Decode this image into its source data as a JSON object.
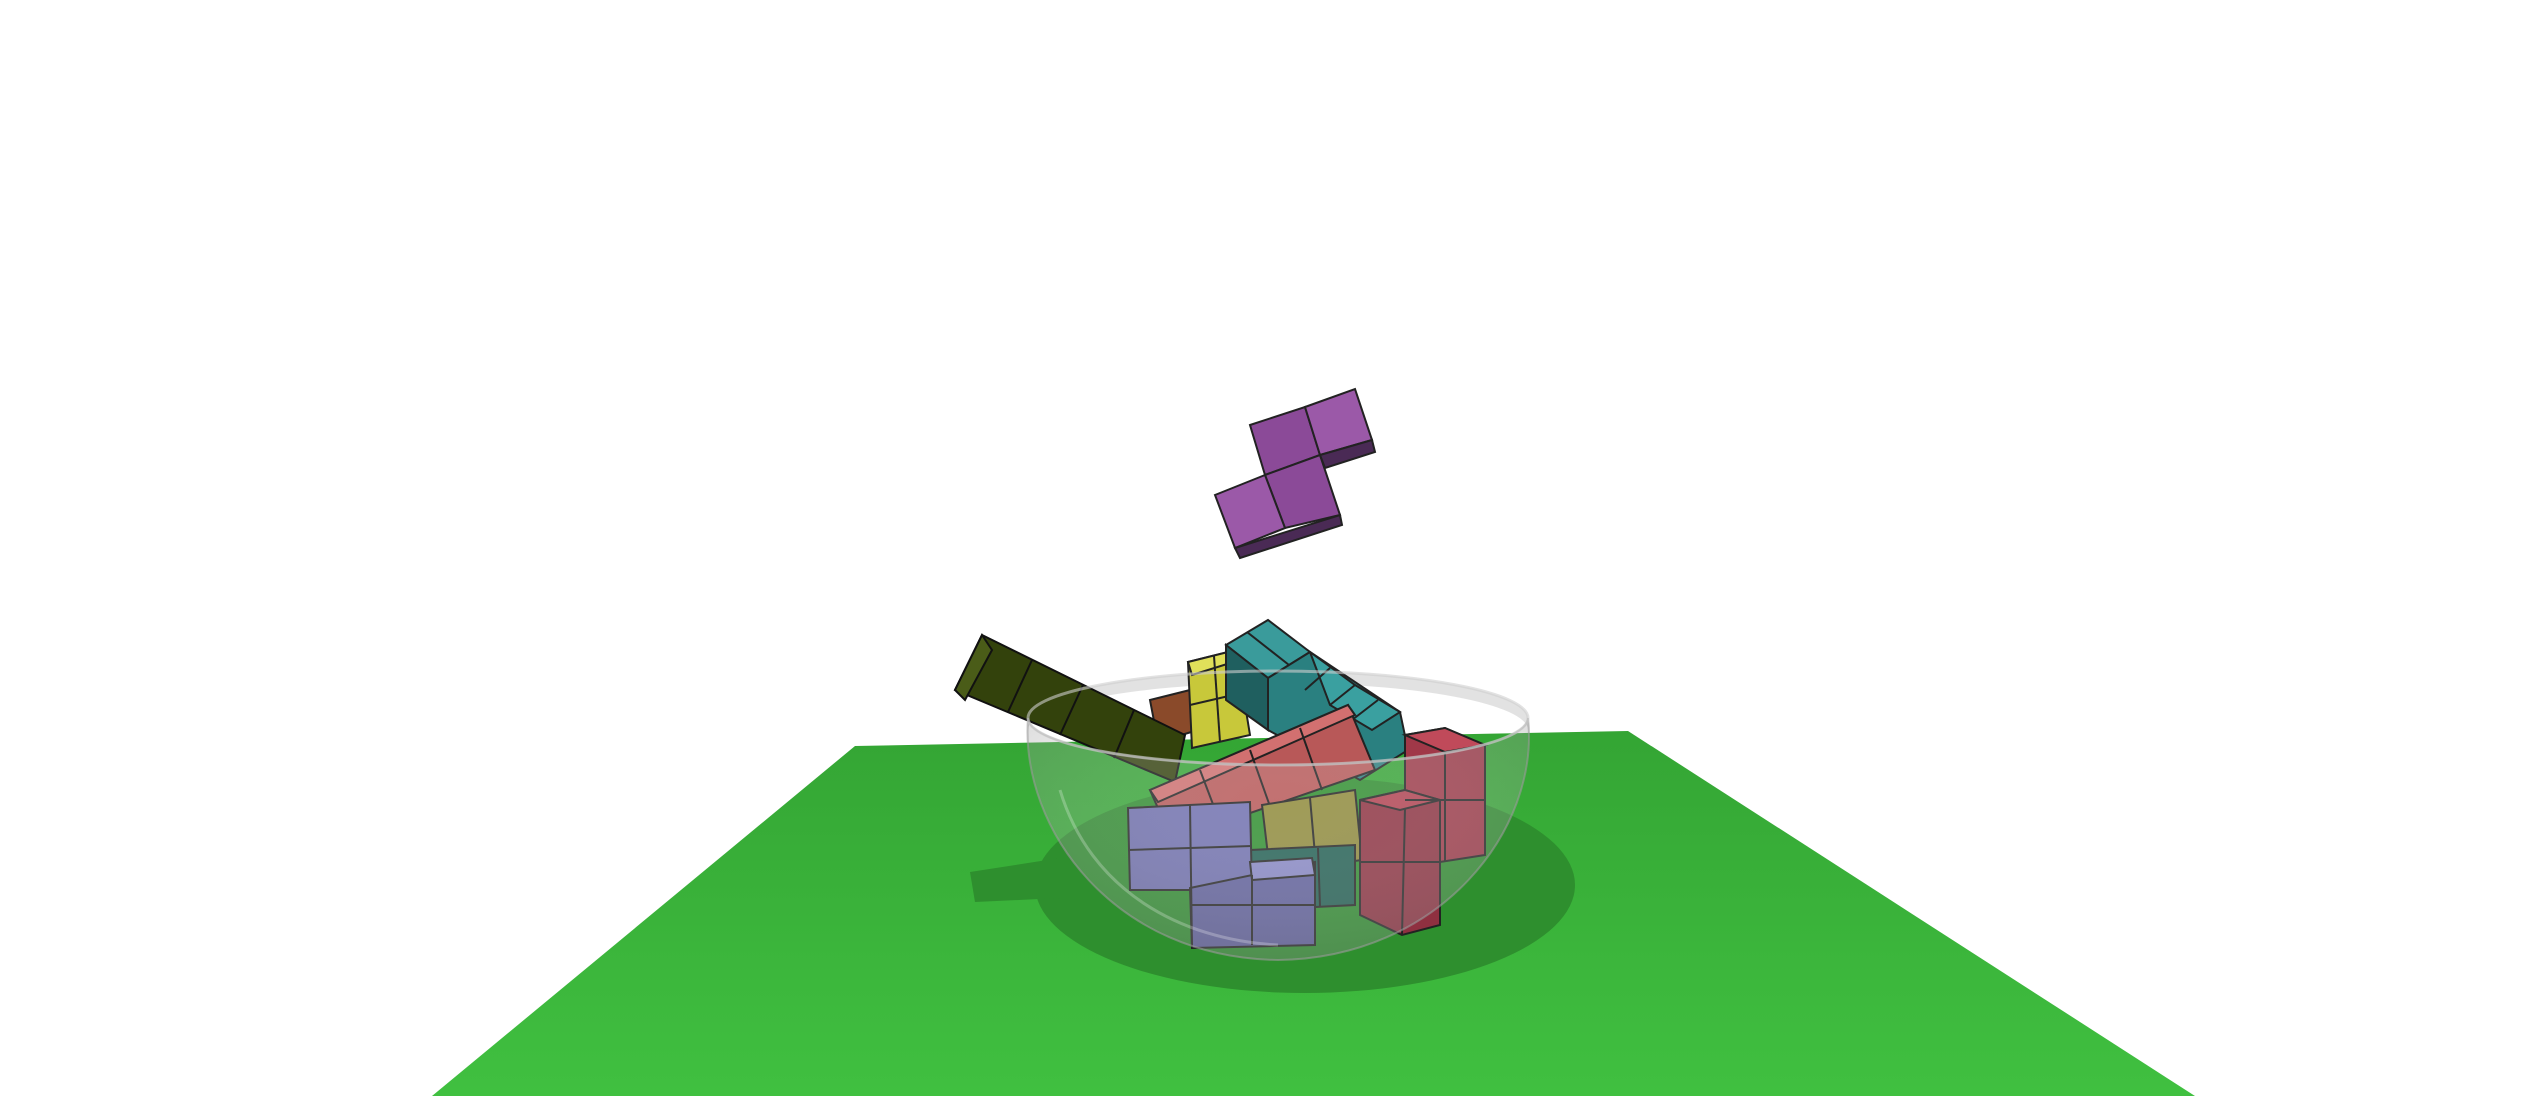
{
  "scene": {
    "background_color": "#ffffff",
    "ground": {
      "icon": "ground-plane",
      "color": "#3db83d",
      "color_far": "#34a534"
    },
    "bowl": {
      "icon": "transparent-hemisphere-bowl",
      "tint": "#b8b8b8",
      "opacity": 0.35,
      "shadow_color": "#2e8f2e"
    },
    "falling_piece": {
      "icon": "s-tetromino-3d",
      "color": "#9b59a8",
      "state": "falling"
    },
    "settled_pieces": [
      {
        "icon": "i-tetromino-3d",
        "color": "#3a4a10"
      },
      {
        "icon": "t-tetromino-3d",
        "color": "#2e8b8b"
      },
      {
        "icon": "o-tetromino-3d",
        "color": "#c8c83a"
      },
      {
        "icon": "i-tetromino-3d",
        "color": "#c06060"
      },
      {
        "icon": "l-tetromino-3d",
        "color": "#a83a4a"
      },
      {
        "icon": "z-tetromino-3d",
        "color": "#6f6fb0"
      },
      {
        "icon": "block-3d",
        "color": "#8a5a3a"
      },
      {
        "icon": "block-3d",
        "color": "#8a8a30"
      },
      {
        "icon": "block-3d",
        "color": "#1f6f5f"
      }
    ]
  }
}
